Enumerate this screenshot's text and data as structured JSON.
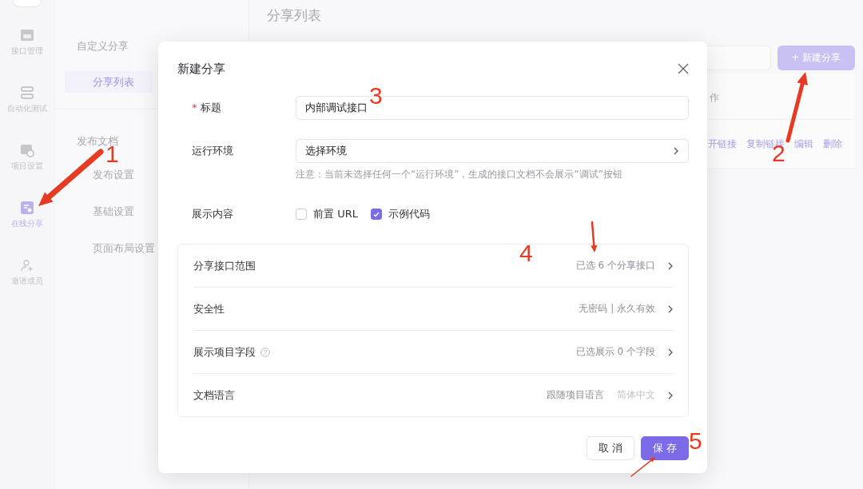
{
  "rail": {
    "items": [
      {
        "label": "接口管理",
        "selected": false
      },
      {
        "label": "自动化测试",
        "selected": false
      },
      {
        "label": "项目设置",
        "selected": false
      },
      {
        "label": "在线分享",
        "selected": true
      },
      {
        "label": "邀请成员",
        "selected": false
      }
    ]
  },
  "sidebar": {
    "groups": [
      {
        "title": "自定义分享",
        "items": [
          {
            "label": "分享列表",
            "selected": true
          }
        ]
      },
      {
        "title": "发布文档",
        "items": [
          {
            "label": "发布设置",
            "selected": false
          },
          {
            "label": "基础设置",
            "selected": false
          },
          {
            "label": "页面布局设置",
            "selected": false
          }
        ]
      }
    ]
  },
  "main": {
    "title": "分享列表",
    "new_button": "+ 新建分享",
    "table": {
      "header": "作",
      "row_actions": [
        "开链接",
        "复制链接",
        "编辑",
        "删除"
      ]
    }
  },
  "dialog": {
    "title": "新建分享",
    "fields": [
      {
        "kind": "text",
        "marker": "*",
        "label": "标题",
        "value": "内部调试接口"
      },
      {
        "kind": "select",
        "label": "运行环境",
        "value": "选择环境",
        "hint": "注意：当前未选择任何一个“运行环境”，生成的接口文档不会展示“调试”按钮"
      },
      {
        "kind": "checkboxes",
        "label": "展示内容",
        "options": [
          {
            "label": "前置 URL",
            "checked": false
          },
          {
            "label": "示例代码",
            "checked": true
          }
        ]
      }
    ],
    "settings": [
      {
        "label": "分享接口范围",
        "help": false,
        "value": "已选 6 个分享接口"
      },
      {
        "label": "安全性",
        "help": false,
        "value": "无密码 | 永久有效"
      },
      {
        "label": "展示项目字段",
        "help": true,
        "value": "已选展示 0 个字段"
      },
      {
        "label": "文档语言",
        "help": false,
        "value": "跟随项目语言",
        "secondary": "简体中文"
      }
    ],
    "buttons": [
      {
        "label": "取 消",
        "kind": "default"
      },
      {
        "label": "保 存",
        "kind": "primary"
      }
    ]
  },
  "annotations": [
    {
      "label": "1"
    },
    {
      "label": "2"
    },
    {
      "label": "3"
    },
    {
      "label": "4"
    },
    {
      "label": "5"
    }
  ]
}
